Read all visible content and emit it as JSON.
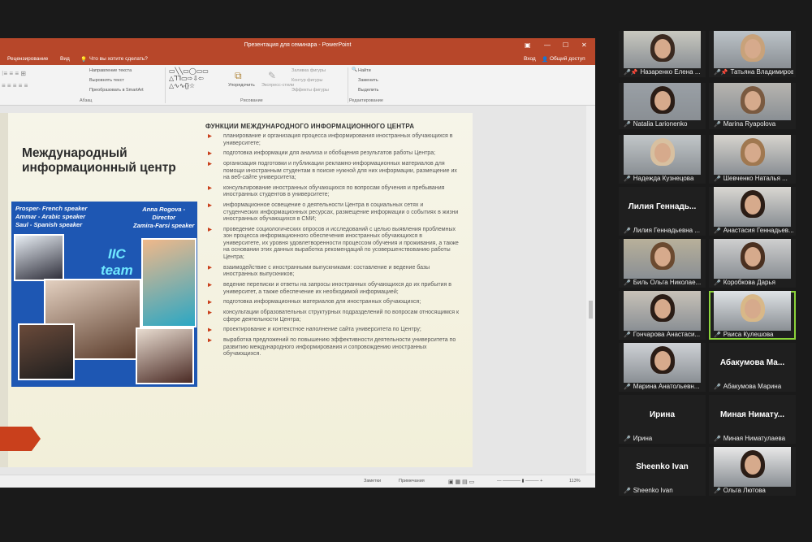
{
  "app": {
    "title": "Презентация для семинара - PowerPoint",
    "menu": {
      "review": "Рецензирование",
      "view": "Вид",
      "tellme": "Что вы хотите сделать?",
      "signin": "Вход",
      "share": "Общий доступ"
    }
  },
  "ribbon": {
    "text_direction": "Направление текста",
    "align_text": "Выровнять текст",
    "smartart": "Преобразовать в SmartArt",
    "arrange": "Упорядочить",
    "quick_styles": "Экспресс-стили",
    "shape_fill": "Заливка фигуры",
    "shape_outline": "Контур фигуры",
    "shape_effects": "Эффекты фигуры",
    "find": "Найти",
    "replace": "Заменить",
    "select": "Выделить",
    "group_paragraph": "Абзац",
    "group_drawing": "Рисование",
    "group_editing": "Редактирование"
  },
  "slide": {
    "heading": "Международный информационный центр",
    "poster": {
      "speakers_left": "Prosper- French speaker\nAmmar - Arabic speaker\nSaul - Spanish speaker",
      "speakers_right": "Anna Rogova -\nDirector\nZamira-Farsi speaker",
      "brand": "IIC\nteam"
    },
    "functions_title": "ФУНКЦИИ МЕЖДУНАРОДНОГО ИНФОРМАЦИОННОГО ЦЕНТРА",
    "functions": [
      "планирование и организация процесса информирования иностранных обучающихся в университете;",
      "подготовка информации для анализа и обобщения результатов работы Центра;",
      "организация подготовки и публикации рекламно-информационных материалов для помощи иностранным студентам в поиске нужной для них информации, размещение их на веб-сайте университета;",
      "консультирование иностранных обучающихся по вопросам обучения и пребывания иностранных студентов в университете;",
      "информационное освещение о деятельности Центра в социальных сетях и студенческих информационных ресурсах, размещение информации о событиях в жизни иностранных обучающихся в СМИ;",
      "проведение социологических опросов и исследований с целью выявления проблемных зон процесса информационного обеспечения иностранных обучающихся в университете, их уровня удовлетворенности процессом обучения и проживания, а также на основании этих данных выработка рекомендаций по усовершенствованию работы Центра;",
      "взаимодействие с иностранными выпускниками: составление и ведение базы иностранных выпускников;",
      "ведение переписки и ответы на запросы иностранных обучающихся до их прибытия в университет, а также обеспечение их необходимой информацией;",
      "подготовка информационных материалов для иностранных обучающихся;",
      "консультации образовательных структурных подразделений по вопросам относящимся к сфере деятельности Центра;",
      "проектирование и контекстное наполнение сайта университета по Центру;",
      "выработка предложений по повышению эффективности деятельности университета по развитию международного информирования и сопровождению иностранных обучающихся."
    ]
  },
  "status": {
    "notes": "Заметки",
    "comments": "Примечания",
    "zoom": "113%"
  },
  "participants": [
    {
      "name": "Назаренко Елена ...",
      "video": true,
      "pinned": true
    },
    {
      "name": "Татьяна Владимиров...",
      "video": true,
      "pinned": true
    },
    {
      "name": "Natalia Larionenko",
      "video": true
    },
    {
      "name": "Marina Ryapolova",
      "video": true
    },
    {
      "name": "Надежда Кузнецова",
      "video": true
    },
    {
      "name": "Шевченко Наталья ...",
      "video": true
    },
    {
      "name": "Лилия Геннадьевна ...",
      "video": false,
      "display": "Лилия Геннадь..."
    },
    {
      "name": "Анастасия Геннадьев...",
      "video": true
    },
    {
      "name": "Биль Ольга Николае...",
      "video": true
    },
    {
      "name": "Коробкова Дарья",
      "video": true
    },
    {
      "name": "Гончарова Анастаси...",
      "video": true
    },
    {
      "name": "Раиса Кулешова",
      "video": true,
      "active": true
    },
    {
      "name": "Марина Анатольевн...",
      "video": true
    },
    {
      "name": "Абакумова Марина",
      "video": false,
      "display": "Абакумова Ма..."
    },
    {
      "name": "Ирина",
      "video": false,
      "display": "Ирина"
    },
    {
      "name": "Миная Ниматулаева",
      "video": false,
      "display": "Миная Нимату..."
    },
    {
      "name": "Sheenko Ivan",
      "video": false,
      "display": "Sheenko Ivan"
    },
    {
      "name": "Ольга Лютова",
      "video": true
    }
  ]
}
